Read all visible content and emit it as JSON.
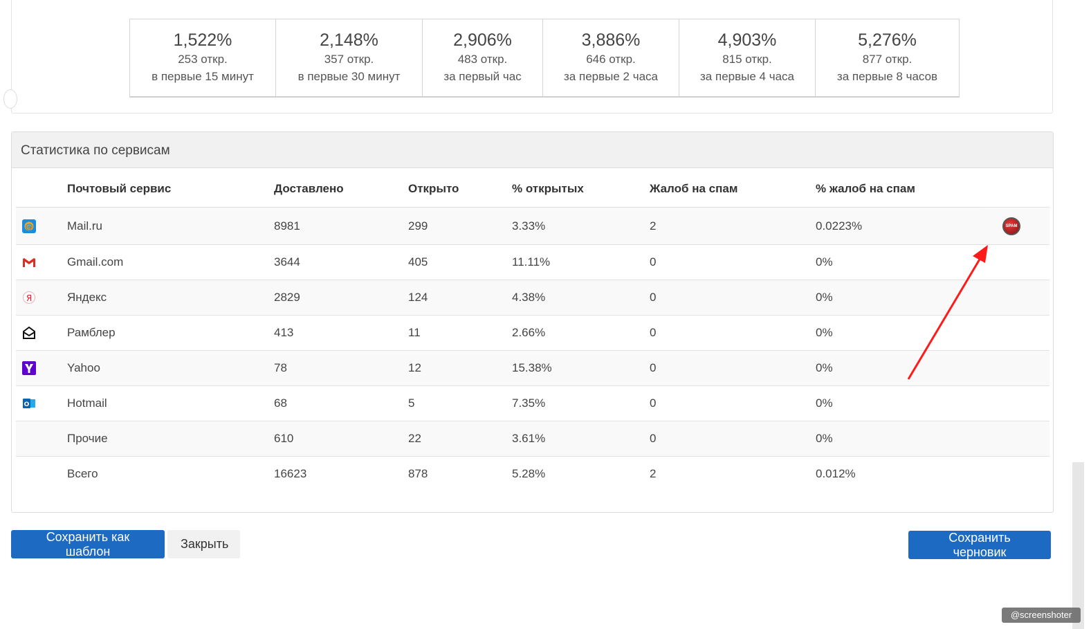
{
  "timing": [
    {
      "percent": "1,522%",
      "opens": "253 откр.",
      "period": "в первые 15 минут"
    },
    {
      "percent": "2,148%",
      "opens": "357 откр.",
      "period": "в первые 30 минут"
    },
    {
      "percent": "2,906%",
      "opens": "483 откр.",
      "period": "за первый час"
    },
    {
      "percent": "3,886%",
      "opens": "646 откр.",
      "period": "за первые 2 часа"
    },
    {
      "percent": "4,903%",
      "opens": "815 откр.",
      "period": "за первые 4 часа"
    },
    {
      "percent": "5,276%",
      "opens": "877 откр.",
      "period": "за первые 8 часов"
    }
  ],
  "services": {
    "title": "Статистика по сервисам",
    "headers": {
      "service": "Почтовый сервис",
      "delivered": "Доставлено",
      "opened": "Открыто",
      "open_pct": "% открытых",
      "spam": "Жалоб на спам",
      "spam_pct": "% жалоб на спам"
    },
    "rows": [
      {
        "icon": "mailru-icon",
        "name": "Mail.ru",
        "delivered": "8981",
        "opened": "299",
        "open_pct": "3.33%",
        "spam": "2",
        "spam_pct": "0.0223%",
        "spam_badge": "SPAM"
      },
      {
        "icon": "gmail-icon",
        "name": "Gmail.com",
        "delivered": "3644",
        "opened": "405",
        "open_pct": "11.11%",
        "spam": "0",
        "spam_pct": "0%"
      },
      {
        "icon": "yandex-icon",
        "name": "Яндекс",
        "delivered": "2829",
        "opened": "124",
        "open_pct": "4.38%",
        "spam": "0",
        "spam_pct": "0%"
      },
      {
        "icon": "rambler-icon",
        "name": "Рамблер",
        "delivered": "413",
        "opened": "11",
        "open_pct": "2.66%",
        "spam": "0",
        "spam_pct": "0%"
      },
      {
        "icon": "yahoo-icon",
        "name": "Yahoo",
        "delivered": "78",
        "opened": "12",
        "open_pct": "15.38%",
        "spam": "0",
        "spam_pct": "0%"
      },
      {
        "icon": "outlook-icon",
        "name": "Hotmail",
        "delivered": "68",
        "opened": "5",
        "open_pct": "7.35%",
        "spam": "0",
        "spam_pct": "0%"
      },
      {
        "icon": "",
        "name": "Прочие",
        "delivered": "610",
        "opened": "22",
        "open_pct": "3.61%",
        "spam": "0",
        "spam_pct": "0%"
      },
      {
        "icon": "",
        "name": "Всего",
        "delivered": "16623",
        "opened": "878",
        "open_pct": "5.28%",
        "spam": "2",
        "spam_pct": "0.012%"
      }
    ]
  },
  "buttons": {
    "save_template": "Сохранить как шаблон",
    "close": "Закрыть",
    "save_draft": "Сохранить черновик"
  },
  "watermark": "@screenshoter",
  "colors": {
    "primary": "#1c6ac2",
    "link": "#26368a",
    "annotation_arrow": "#ff1a1a"
  }
}
